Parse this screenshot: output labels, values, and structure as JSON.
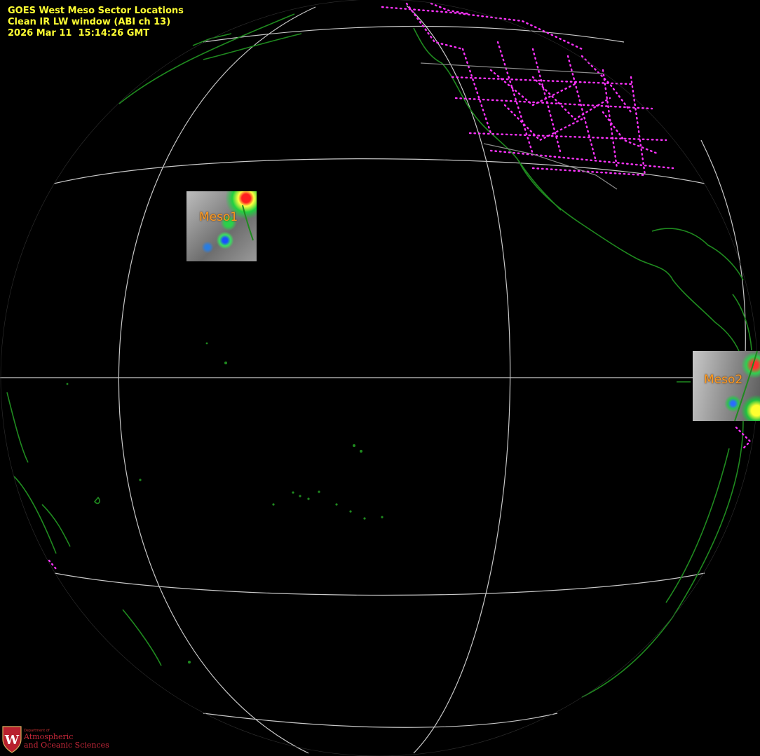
{
  "header": {
    "title": "GOES West Meso Sector Locations",
    "product": "Clean IR LW window (ABI ch 13)",
    "timestamp": "2026 Mar 11  15:14:26 GMT"
  },
  "sectors": [
    {
      "label": "Meso1"
    },
    {
      "label": "Meso2"
    }
  ],
  "logo": {
    "dept": "Department of",
    "line1": "Atmospheric",
    "line2": "and Oceanic Sciences",
    "crest_letter": "W"
  },
  "colors": {
    "background": "#000000",
    "header_text": "#ffff33",
    "coastline": "#1f8a1f",
    "political_borders": "#ff33ff",
    "graticule": "#c8c8c8",
    "sector_label": "#ff9a1f"
  }
}
